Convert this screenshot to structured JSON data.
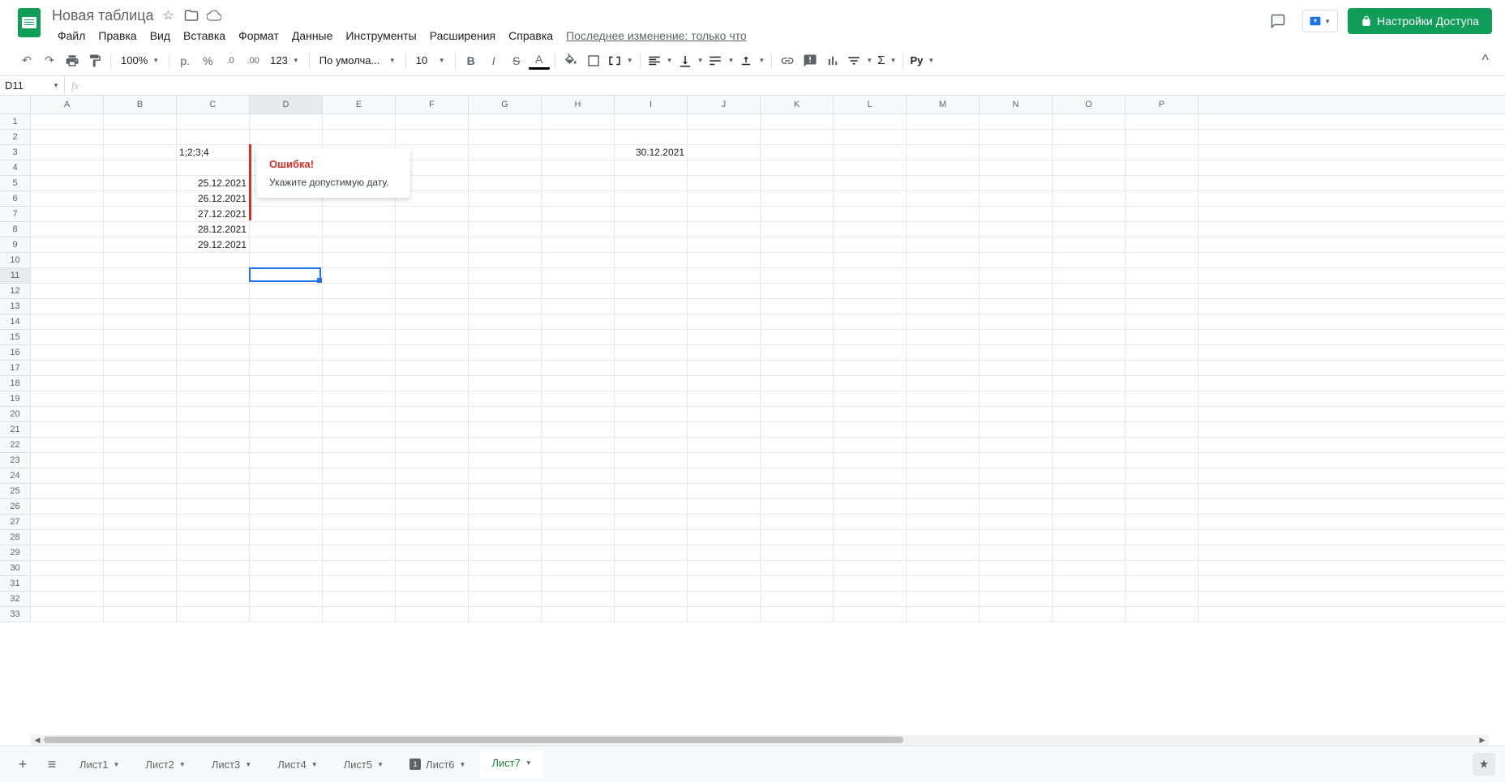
{
  "doc": {
    "title": "Новая таблица"
  },
  "menu": {
    "file": "Файл",
    "edit": "Правка",
    "view": "Вид",
    "insert": "Вставка",
    "format": "Формат",
    "data": "Данные",
    "tools": "Инструменты",
    "extensions": "Расширения",
    "help": "Справка",
    "last_change": "Последнее изменение: только что"
  },
  "share": {
    "label": "Настройки Доступа"
  },
  "toolbar": {
    "zoom": "100%",
    "currency": "р.",
    "percent": "%",
    "font": "По умолча...",
    "font_size": "10"
  },
  "namebox": {
    "value": "D11"
  },
  "columns": [
    "A",
    "B",
    "C",
    "D",
    "E",
    "F",
    "G",
    "H",
    "I",
    "J",
    "K",
    "L",
    "M",
    "N",
    "O",
    "P"
  ],
  "row_count": 33,
  "cells": {
    "C3": "1;2;3;4",
    "I3": "30.12.2021",
    "C5": "25.12.2021",
    "C6": "26.12.2021",
    "C7": "27.12.2021",
    "C8": "28.12.2021",
    "C9": "29.12.2021"
  },
  "error": {
    "title": "Ошибка!",
    "body": "Укажите допустимую дату."
  },
  "active_cell": "D11",
  "invalid_cell": "D3",
  "sheets": [
    {
      "name": "Лист1"
    },
    {
      "name": "Лист2"
    },
    {
      "name": "Лист3"
    },
    {
      "name": "Лист4"
    },
    {
      "name": "Лист5"
    },
    {
      "name": "Лист6",
      "indicator": "1"
    },
    {
      "name": "Лист7",
      "active": true
    }
  ]
}
